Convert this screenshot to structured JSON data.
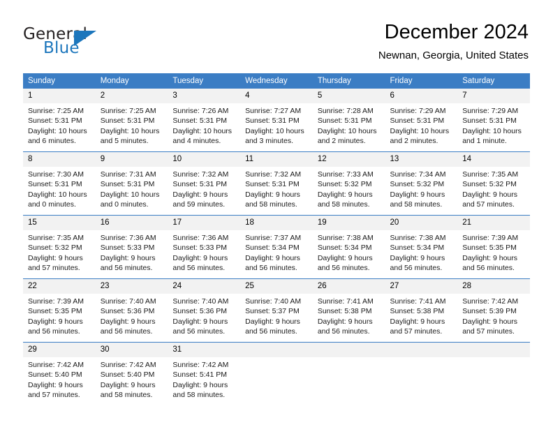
{
  "brand": {
    "name_part1": "General",
    "name_part2": "Blue",
    "accent_color": "#1c76bc"
  },
  "header": {
    "title": "December 2024",
    "subtitle": "Newnan, Georgia, United States"
  },
  "theme": {
    "header_row_bg": "#3b7dc4",
    "daynum_bg": "#f2f2f2",
    "grid_line": "#3b7dc4"
  },
  "weekday_headers": [
    "Sunday",
    "Monday",
    "Tuesday",
    "Wednesday",
    "Thursday",
    "Friday",
    "Saturday"
  ],
  "labels": {
    "sunrise_prefix": "Sunrise:",
    "sunset_prefix": "Sunset:",
    "daylight_prefix": "Daylight:"
  },
  "weeks": [
    [
      {
        "day": "1",
        "sunrise": "Sunrise: 7:25 AM",
        "sunset": "Sunset: 5:31 PM",
        "daylight1": "Daylight: 10 hours",
        "daylight2": "and 6 minutes."
      },
      {
        "day": "2",
        "sunrise": "Sunrise: 7:25 AM",
        "sunset": "Sunset: 5:31 PM",
        "daylight1": "Daylight: 10 hours",
        "daylight2": "and 5 minutes."
      },
      {
        "day": "3",
        "sunrise": "Sunrise: 7:26 AM",
        "sunset": "Sunset: 5:31 PM",
        "daylight1": "Daylight: 10 hours",
        "daylight2": "and 4 minutes."
      },
      {
        "day": "4",
        "sunrise": "Sunrise: 7:27 AM",
        "sunset": "Sunset: 5:31 PM",
        "daylight1": "Daylight: 10 hours",
        "daylight2": "and 3 minutes."
      },
      {
        "day": "5",
        "sunrise": "Sunrise: 7:28 AM",
        "sunset": "Sunset: 5:31 PM",
        "daylight1": "Daylight: 10 hours",
        "daylight2": "and 2 minutes."
      },
      {
        "day": "6",
        "sunrise": "Sunrise: 7:29 AM",
        "sunset": "Sunset: 5:31 PM",
        "daylight1": "Daylight: 10 hours",
        "daylight2": "and 2 minutes."
      },
      {
        "day": "7",
        "sunrise": "Sunrise: 7:29 AM",
        "sunset": "Sunset: 5:31 PM",
        "daylight1": "Daylight: 10 hours",
        "daylight2": "and 1 minute."
      }
    ],
    [
      {
        "day": "8",
        "sunrise": "Sunrise: 7:30 AM",
        "sunset": "Sunset: 5:31 PM",
        "daylight1": "Daylight: 10 hours",
        "daylight2": "and 0 minutes."
      },
      {
        "day": "9",
        "sunrise": "Sunrise: 7:31 AM",
        "sunset": "Sunset: 5:31 PM",
        "daylight1": "Daylight: 10 hours",
        "daylight2": "and 0 minutes."
      },
      {
        "day": "10",
        "sunrise": "Sunrise: 7:32 AM",
        "sunset": "Sunset: 5:31 PM",
        "daylight1": "Daylight: 9 hours",
        "daylight2": "and 59 minutes."
      },
      {
        "day": "11",
        "sunrise": "Sunrise: 7:32 AM",
        "sunset": "Sunset: 5:31 PM",
        "daylight1": "Daylight: 9 hours",
        "daylight2": "and 58 minutes."
      },
      {
        "day": "12",
        "sunrise": "Sunrise: 7:33 AM",
        "sunset": "Sunset: 5:32 PM",
        "daylight1": "Daylight: 9 hours",
        "daylight2": "and 58 minutes."
      },
      {
        "day": "13",
        "sunrise": "Sunrise: 7:34 AM",
        "sunset": "Sunset: 5:32 PM",
        "daylight1": "Daylight: 9 hours",
        "daylight2": "and 58 minutes."
      },
      {
        "day": "14",
        "sunrise": "Sunrise: 7:35 AM",
        "sunset": "Sunset: 5:32 PM",
        "daylight1": "Daylight: 9 hours",
        "daylight2": "and 57 minutes."
      }
    ],
    [
      {
        "day": "15",
        "sunrise": "Sunrise: 7:35 AM",
        "sunset": "Sunset: 5:32 PM",
        "daylight1": "Daylight: 9 hours",
        "daylight2": "and 57 minutes."
      },
      {
        "day": "16",
        "sunrise": "Sunrise: 7:36 AM",
        "sunset": "Sunset: 5:33 PM",
        "daylight1": "Daylight: 9 hours",
        "daylight2": "and 56 minutes."
      },
      {
        "day": "17",
        "sunrise": "Sunrise: 7:36 AM",
        "sunset": "Sunset: 5:33 PM",
        "daylight1": "Daylight: 9 hours",
        "daylight2": "and 56 minutes."
      },
      {
        "day": "18",
        "sunrise": "Sunrise: 7:37 AM",
        "sunset": "Sunset: 5:34 PM",
        "daylight1": "Daylight: 9 hours",
        "daylight2": "and 56 minutes."
      },
      {
        "day": "19",
        "sunrise": "Sunrise: 7:38 AM",
        "sunset": "Sunset: 5:34 PM",
        "daylight1": "Daylight: 9 hours",
        "daylight2": "and 56 minutes."
      },
      {
        "day": "20",
        "sunrise": "Sunrise: 7:38 AM",
        "sunset": "Sunset: 5:34 PM",
        "daylight1": "Daylight: 9 hours",
        "daylight2": "and 56 minutes."
      },
      {
        "day": "21",
        "sunrise": "Sunrise: 7:39 AM",
        "sunset": "Sunset: 5:35 PM",
        "daylight1": "Daylight: 9 hours",
        "daylight2": "and 56 minutes."
      }
    ],
    [
      {
        "day": "22",
        "sunrise": "Sunrise: 7:39 AM",
        "sunset": "Sunset: 5:35 PM",
        "daylight1": "Daylight: 9 hours",
        "daylight2": "and 56 minutes."
      },
      {
        "day": "23",
        "sunrise": "Sunrise: 7:40 AM",
        "sunset": "Sunset: 5:36 PM",
        "daylight1": "Daylight: 9 hours",
        "daylight2": "and 56 minutes."
      },
      {
        "day": "24",
        "sunrise": "Sunrise: 7:40 AM",
        "sunset": "Sunset: 5:36 PM",
        "daylight1": "Daylight: 9 hours",
        "daylight2": "and 56 minutes."
      },
      {
        "day": "25",
        "sunrise": "Sunrise: 7:40 AM",
        "sunset": "Sunset: 5:37 PM",
        "daylight1": "Daylight: 9 hours",
        "daylight2": "and 56 minutes."
      },
      {
        "day": "26",
        "sunrise": "Sunrise: 7:41 AM",
        "sunset": "Sunset: 5:38 PM",
        "daylight1": "Daylight: 9 hours",
        "daylight2": "and 56 minutes."
      },
      {
        "day": "27",
        "sunrise": "Sunrise: 7:41 AM",
        "sunset": "Sunset: 5:38 PM",
        "daylight1": "Daylight: 9 hours",
        "daylight2": "and 57 minutes."
      },
      {
        "day": "28",
        "sunrise": "Sunrise: 7:42 AM",
        "sunset": "Sunset: 5:39 PM",
        "daylight1": "Daylight: 9 hours",
        "daylight2": "and 57 minutes."
      }
    ],
    [
      {
        "day": "29",
        "sunrise": "Sunrise: 7:42 AM",
        "sunset": "Sunset: 5:40 PM",
        "daylight1": "Daylight: 9 hours",
        "daylight2": "and 57 minutes."
      },
      {
        "day": "30",
        "sunrise": "Sunrise: 7:42 AM",
        "sunset": "Sunset: 5:40 PM",
        "daylight1": "Daylight: 9 hours",
        "daylight2": "and 58 minutes."
      },
      {
        "day": "31",
        "sunrise": "Sunrise: 7:42 AM",
        "sunset": "Sunset: 5:41 PM",
        "daylight1": "Daylight: 9 hours",
        "daylight2": "and 58 minutes."
      },
      {
        "day": "",
        "sunrise": "",
        "sunset": "",
        "daylight1": "",
        "daylight2": ""
      },
      {
        "day": "",
        "sunrise": "",
        "sunset": "",
        "daylight1": "",
        "daylight2": ""
      },
      {
        "day": "",
        "sunrise": "",
        "sunset": "",
        "daylight1": "",
        "daylight2": ""
      },
      {
        "day": "",
        "sunrise": "",
        "sunset": "",
        "daylight1": "",
        "daylight2": ""
      }
    ]
  ]
}
